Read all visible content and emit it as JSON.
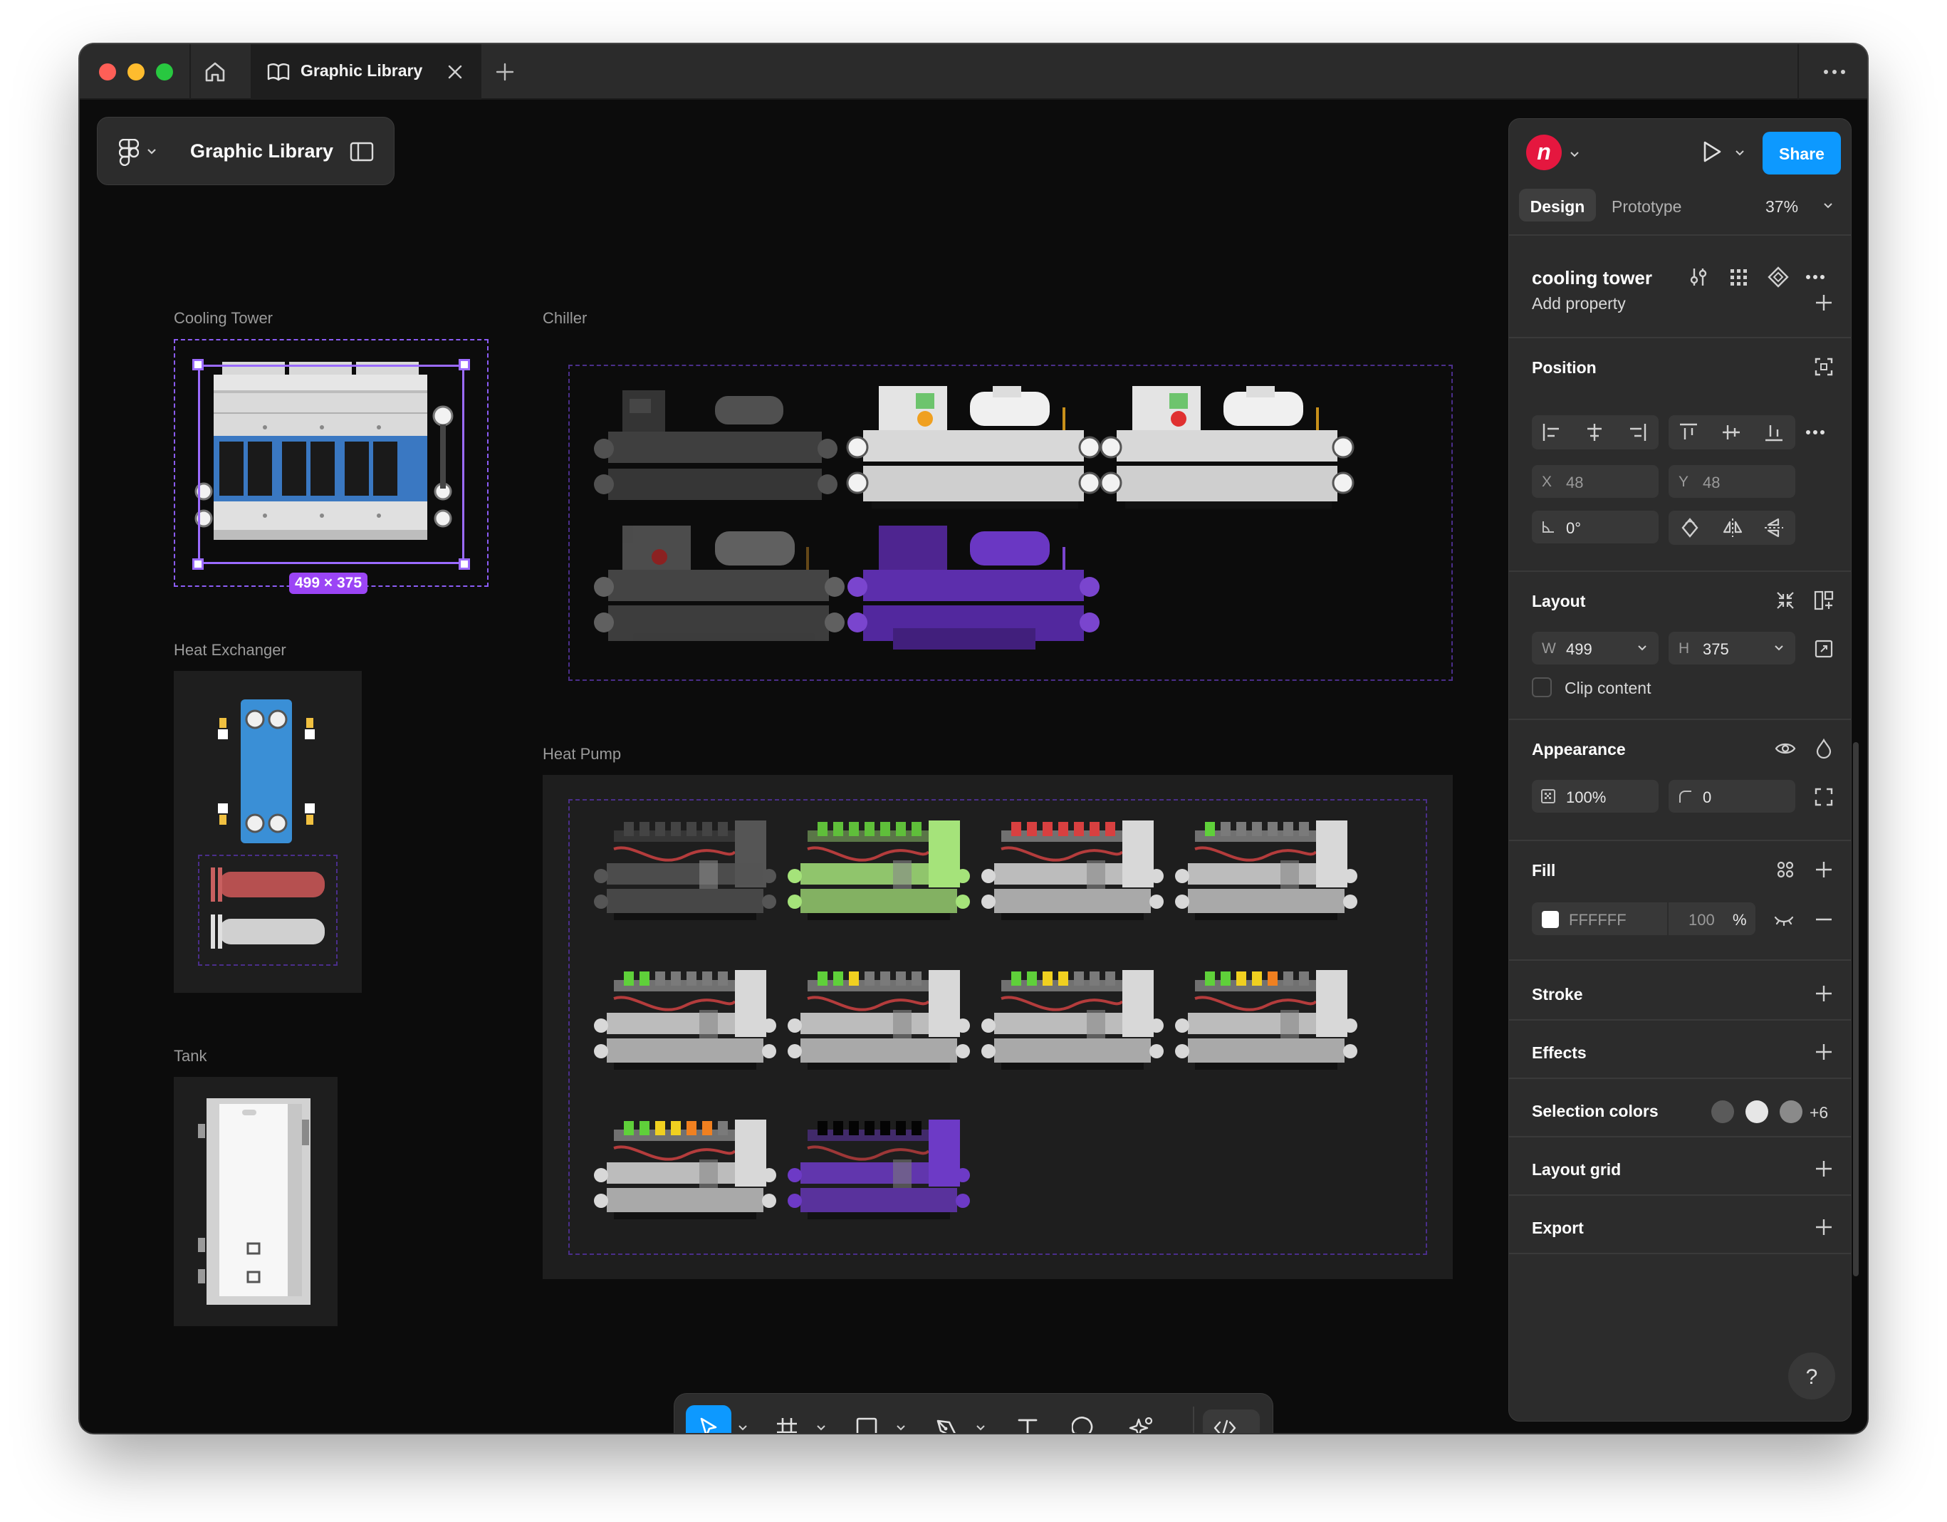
{
  "window": {
    "tab_title": "Graphic Library"
  },
  "file": {
    "name": "Graphic Library"
  },
  "frames": {
    "cooling_tower": "Cooling Tower",
    "chiller": "Chiller",
    "heat_exchanger": "Heat Exchanger",
    "heat_pump": "Heat Pump",
    "tank": "Tank"
  },
  "selection": {
    "size_badge": "499 × 375"
  },
  "panel": {
    "avatar_letter": "n",
    "share_label": "Share",
    "tab_design": "Design",
    "tab_prototype": "Prototype",
    "zoom": "37%",
    "component_name": "cooling tower",
    "add_property": "Add property",
    "position": {
      "title": "Position",
      "x_label": "X",
      "x_value": "48",
      "y_label": "Y",
      "y_value": "48",
      "rotation": "0°"
    },
    "layout": {
      "title": "Layout",
      "w_label": "W",
      "w_value": "499",
      "h_label": "H",
      "h_value": "375",
      "clip_content": "Clip content"
    },
    "appearance": {
      "title": "Appearance",
      "opacity": "100%",
      "radius": "0"
    },
    "fill": {
      "title": "Fill",
      "hex": "FFFFFF",
      "opacity": "100",
      "percent": "%"
    },
    "stroke": "Stroke",
    "effects": "Effects",
    "selection_colors": {
      "title": "Selection colors",
      "more": "+6",
      "colors": [
        "#5a5a5a",
        "#e6e6e6",
        "#8a8a8a"
      ]
    },
    "layout_grid": "Layout grid",
    "export": "Export",
    "help": "?"
  },
  "colors": {
    "accent": "#0d99ff",
    "selection": "#9b6bff",
    "component_purple": "#7b3fe4",
    "frame_bg": "#1e1e1e",
    "canvas_bg": "#0c0c0c",
    "highlight_green": "#a5e37a"
  }
}
